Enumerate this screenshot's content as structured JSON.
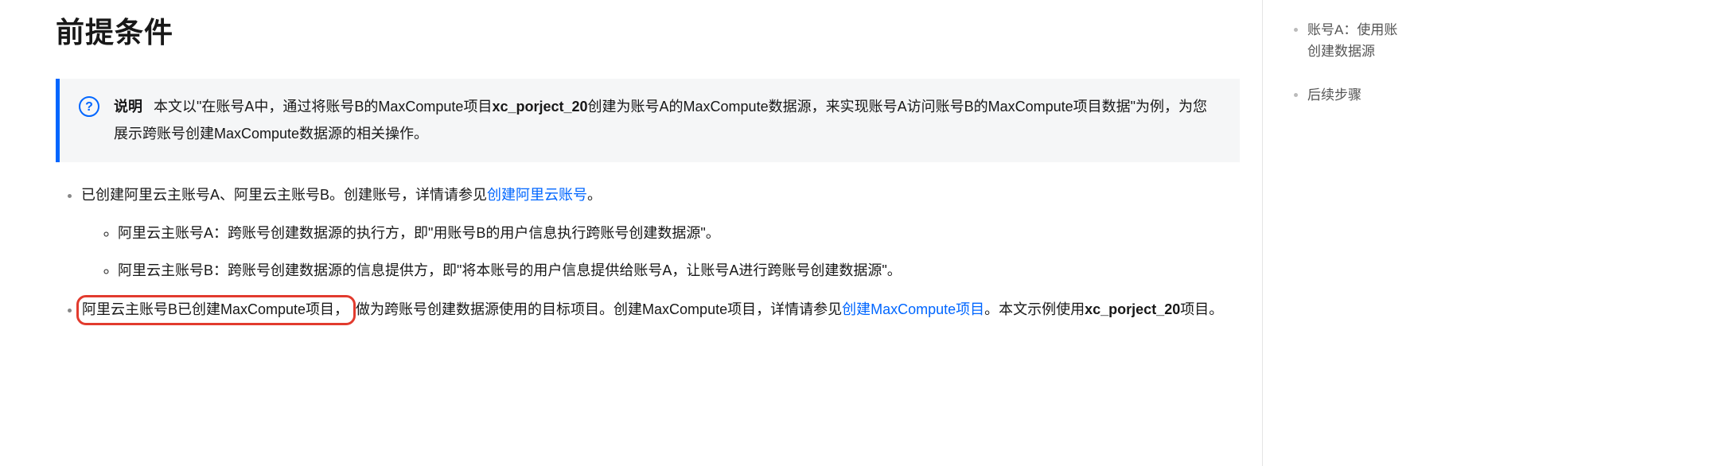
{
  "heading": "前提条件",
  "note": {
    "label": "说明",
    "text_before_bold": "本文以\"在账号A中，通过将账号B的MaxCompute项目",
    "bold": "xc_porject_20",
    "text_after_bold": "创建为账号A的MaxCompute数据源，来实现账号A访问账号B的MaxCompute项目数据\"为例，为您展示跨账号创建MaxCompute数据源的相关操作。"
  },
  "bullet1": {
    "text_before_link": "已创建阿里云主账号A、阿里云主账号B。创建账号，详情请参见",
    "link": "创建阿里云账号",
    "text_after_link": "。"
  },
  "sub1": "阿里云主账号A：跨账号创建数据源的执行方，即\"用账号B的用户信息执行跨账号创建数据源\"。",
  "sub2": "阿里云主账号B：跨账号创建数据源的信息提供方，即\"将本账号的用户信息提供给账号A，让账号A进行跨账号创建数据源\"。",
  "bullet2": {
    "highlight": "阿里云主账号B已创建MaxCompute项目，",
    "text1": "做为跨账号创建数据源使用的目标项目。创建MaxCompute项目，详情请参见",
    "link": "创建MaxCompute项目",
    "text2": "。本文示例使用",
    "bold": "xc_porject_20",
    "text3": "项目。"
  },
  "toc": {
    "item1_line1": "账号A：使用账",
    "item1_line2": "创建数据源",
    "item2": "后续步骤"
  }
}
